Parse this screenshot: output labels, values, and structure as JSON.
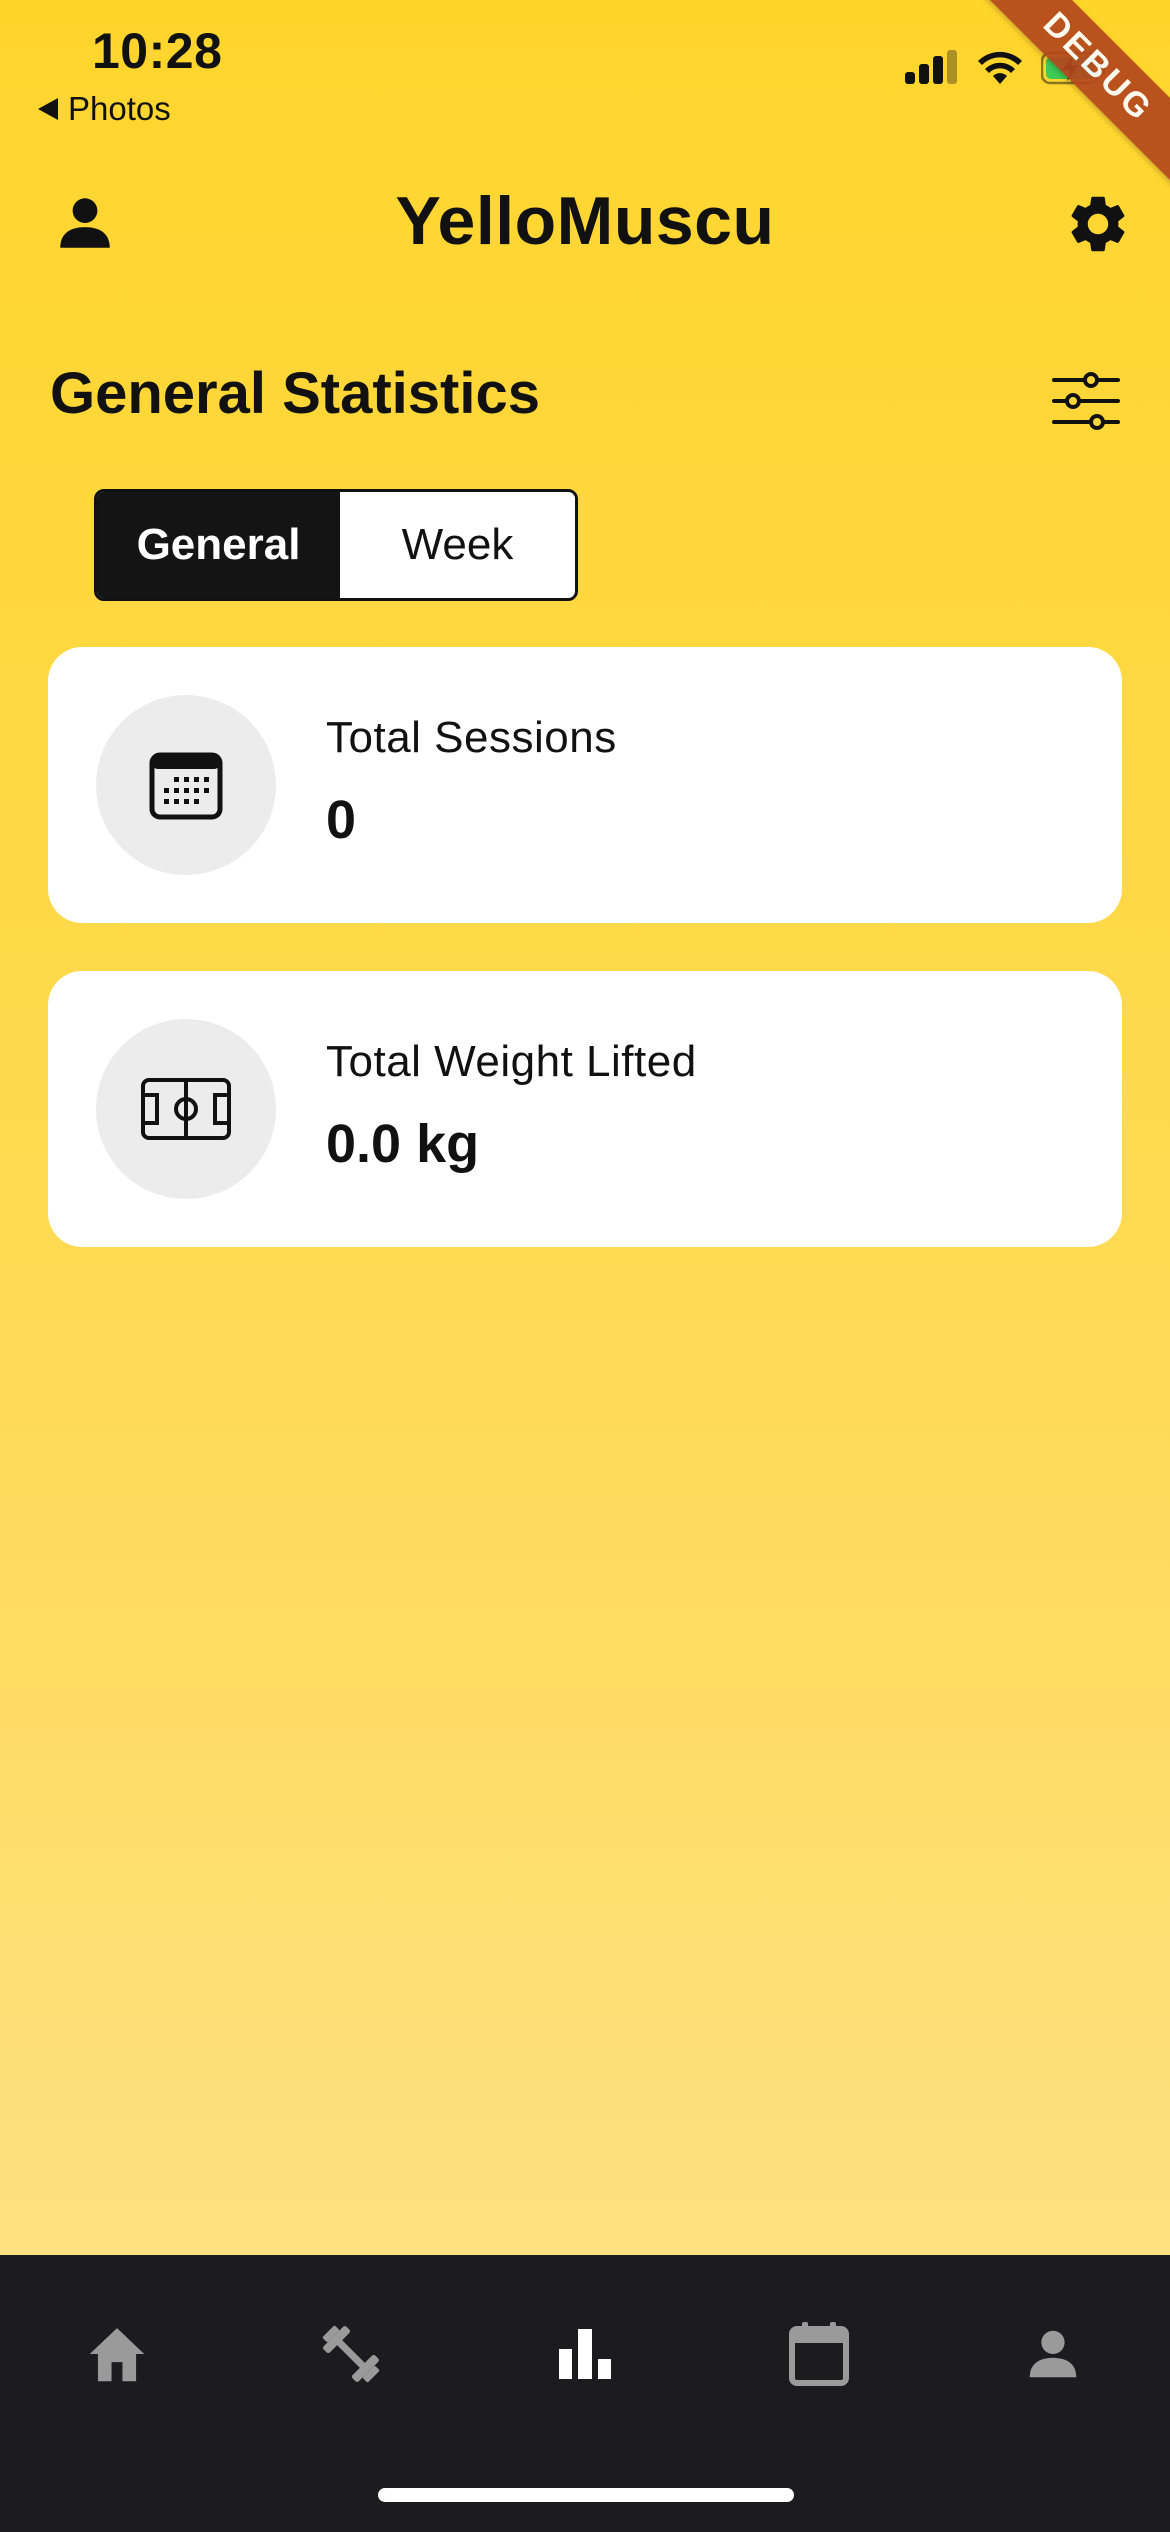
{
  "status_bar": {
    "time": "10:28",
    "back_label": "Photos",
    "icons": [
      "signal-icon",
      "wifi-icon",
      "battery-charging-icon"
    ]
  },
  "debug_banner": {
    "label": "DEBUG",
    "color": "#B5471D"
  },
  "app_bar": {
    "title": "YelloMuscu",
    "left_icon": "person-icon",
    "right_icon": "gear-icon"
  },
  "section": {
    "title": "General Statistics",
    "filter_icon": "sliders-icon"
  },
  "segmented_control": {
    "options": [
      {
        "label": "General",
        "selected": true
      },
      {
        "label": "Week",
        "selected": false
      }
    ]
  },
  "stats": [
    {
      "icon": "calendar-icon",
      "label": "Total Sessions",
      "value": "0"
    },
    {
      "icon": "stadium-icon",
      "label": "Total Weight Lifted",
      "value": "0.0 kg"
    }
  ],
  "bottom_nav": {
    "items": [
      {
        "icon": "home-icon",
        "active": false
      },
      {
        "icon": "dumbbell-icon",
        "active": false
      },
      {
        "icon": "bar-chart-icon",
        "active": true
      },
      {
        "icon": "calendar-icon",
        "active": false
      },
      {
        "icon": "person-icon",
        "active": false
      }
    ]
  },
  "colors": {
    "background_top": "#FFD52C",
    "background_bottom": "#FDE080",
    "card": "#FFFFFF",
    "nav_background": "#1C1C1E",
    "nav_active": "#FFFFFF",
    "nav_inactive": "#9A9A9A",
    "segment_selected": "#141414"
  }
}
